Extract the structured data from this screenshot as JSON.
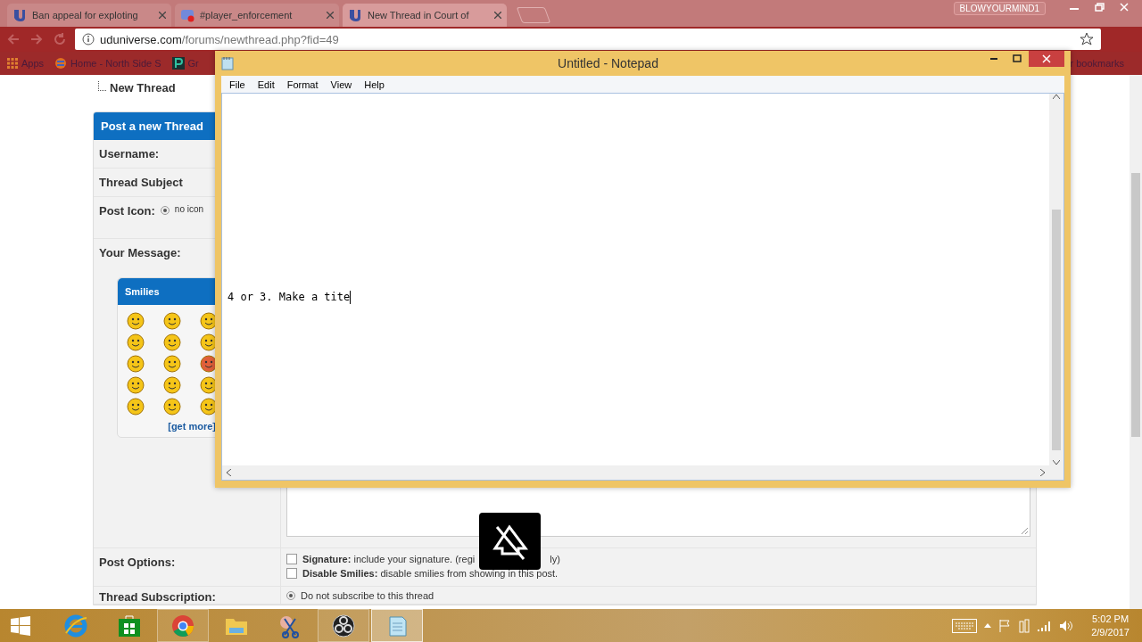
{
  "browser": {
    "tabs": [
      {
        "title": "Ban appeal for exploting",
        "selected": false
      },
      {
        "title": "#player_enforcement",
        "selected": false
      },
      {
        "title": "New Thread in Court of",
        "selected": true
      }
    ],
    "profile": "BLOWYOURMIND1",
    "url_host": "uduniverse.com",
    "url_path": "/forums/newthread.php?fid=49",
    "bookmarks": [
      "Apps",
      "Home - North Side S",
      "Gr"
    ],
    "bookmarks_right": "r bookmarks"
  },
  "page": {
    "breadcrumb": "New Thread",
    "form_title": "Post a new Thread",
    "username_label": "Username:",
    "subject_label": "Thread Subject",
    "post_icon": {
      "label": "Post Icon:",
      "option": "no icon",
      "selected": true
    },
    "message_label": "Your Message:",
    "smilies": {
      "title": "Smilies",
      "link": "[get more]"
    },
    "post_options": {
      "label": "Post Options:",
      "options": [
        {
          "term": "Signature:",
          "text": "include your signature. (regi",
          "text_after": "ly)",
          "checked": false
        },
        {
          "term": "Disable Smilies:",
          "text": "disable smilies from showing in this post.",
          "checked": false
        }
      ]
    },
    "subscription": {
      "label": "Thread Subscription:",
      "options": [
        {
          "text": "Do not subscribe to this thread",
          "selected": true
        }
      ]
    }
  },
  "notepad": {
    "title": "Untitled - Notepad",
    "menu": [
      "File",
      "Edit",
      "Format",
      "View",
      "Help"
    ],
    "text": "4 or 3. Make a tite"
  },
  "taskbar": {
    "apps": [
      {
        "kind": "ie",
        "running": false,
        "active": false
      },
      {
        "kind": "store",
        "running": false,
        "active": false
      },
      {
        "kind": "chrome",
        "running": true,
        "active": false
      },
      {
        "kind": "folder",
        "running": false,
        "active": false
      },
      {
        "kind": "scissors",
        "running": false,
        "active": false
      },
      {
        "kind": "obs",
        "running": true,
        "active": false
      },
      {
        "kind": "notepad",
        "running": true,
        "active": true
      }
    ],
    "time": "5:02 PM",
    "date": "2/9/2017"
  }
}
